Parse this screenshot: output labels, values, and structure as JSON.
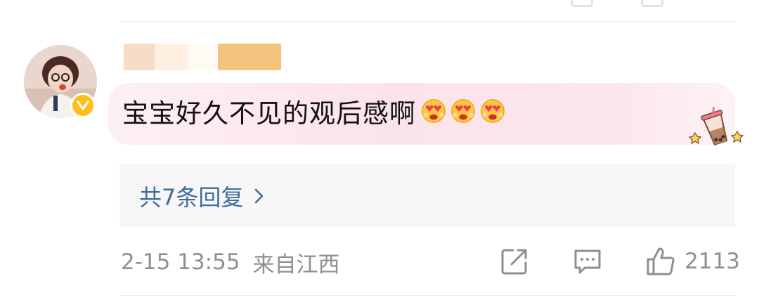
{
  "comment": {
    "text": "宝宝好久不见的观后感啊",
    "emojis": [
      "heart-eyes-emoji",
      "heart-eyes-emoji",
      "heart-eyes-emoji"
    ]
  },
  "replies": {
    "label": "共7条回复",
    "chevron_icon": "chevron-right-icon"
  },
  "meta": {
    "timestamp": "2-15 13:55",
    "location": "来自江西"
  },
  "actions": {
    "share_icon": "share-icon",
    "comment_icon": "comment-icon",
    "like_icon": "thumbs-up-icon",
    "like_count": "2113"
  },
  "colors": {
    "reply_link": "#3f6c9c",
    "meta_text": "#8f8f8f",
    "verified_badge": "#ffbf1a",
    "bubble_pink": "#fbe3ea",
    "reply_box_bg": "#f7f7f7"
  }
}
